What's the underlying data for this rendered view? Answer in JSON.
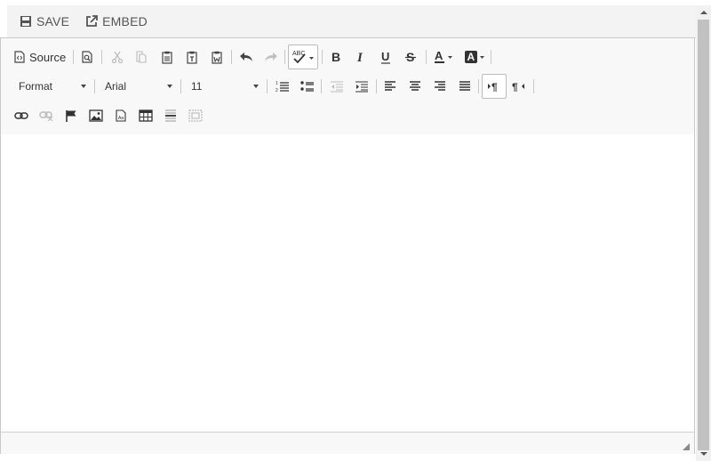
{
  "topbar": {
    "save_label": "SAVE",
    "embed_label": "EMBED"
  },
  "toolbar": {
    "source_label": "Source",
    "format": {
      "selected": "Format"
    },
    "font": {
      "selected": "Arial"
    },
    "size": {
      "selected": "11"
    }
  },
  "icons": [
    "document-icon",
    "preview-icon",
    "cut-icon",
    "copy-icon",
    "paste-icon",
    "paste-text-icon",
    "paste-word-icon",
    "undo-icon",
    "redo-icon",
    "spellcheck-icon",
    "bold-icon",
    "italic-icon",
    "underline-icon",
    "strikethrough-icon",
    "text-color-icon",
    "background-color-icon",
    "numbered-list-icon",
    "bulleted-list-icon",
    "outdent-icon",
    "indent-icon",
    "align-left-icon",
    "align-center-icon",
    "align-right-icon",
    "justify-icon",
    "ltr-icon",
    "rtl-icon",
    "link-icon",
    "unlink-icon",
    "anchor-icon",
    "image-icon",
    "flash-icon",
    "table-icon",
    "horizontal-rule-icon",
    "iframe-icon",
    "resize-icon"
  ],
  "colors": {
    "toolbar_bg": "#f8f8f8",
    "border": "#c9c9c9",
    "topbar_bg": "#f3f3f3"
  }
}
